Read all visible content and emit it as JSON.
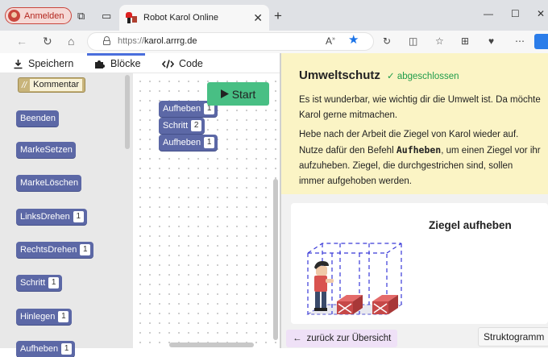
{
  "browser": {
    "profile_label": "Anmelden",
    "tab_title": "Robot Karol Online",
    "url_protocol": "https://",
    "url_host": "karol.arrrg.de",
    "accent_color": "#1a73e8"
  },
  "editor": {
    "tabs": [
      {
        "label": "Speichern",
        "icon": "download-icon"
      },
      {
        "label": "Blöcke",
        "icon": "puzzle-icon"
      },
      {
        "label": "Code",
        "icon": "code-icon"
      }
    ],
    "palette": {
      "comment": {
        "slash": "//",
        "label": "Kommentar"
      },
      "blocks": [
        {
          "label": "Beenden",
          "num": ""
        },
        {
          "label": "MarkeSetzen",
          "num": ""
        },
        {
          "label": "MarkeLöschen",
          "num": ""
        },
        {
          "label": "LinksDrehen",
          "num": "1"
        },
        {
          "label": "RechtsDrehen",
          "num": "1"
        },
        {
          "label": "Schritt",
          "num": "1"
        },
        {
          "label": "Hinlegen",
          "num": "1"
        },
        {
          "label": "Aufheben",
          "num": "1"
        }
      ]
    },
    "program": [
      {
        "label": "Aufheben",
        "num": "1"
      },
      {
        "label": "Schritt",
        "num": "2"
      },
      {
        "label": "Aufheben",
        "num": "1"
      }
    ],
    "start_label": "Start",
    "block_color": "#5c68a6",
    "start_color": "#48bf84"
  },
  "task": {
    "title": "Umweltschutz",
    "status": "abgeschlossen",
    "status_color": "#1f9c4a",
    "para1": "Es ist wunderbar, wie wichtig dir die Umwelt ist. Da möchte Karol gerne mitmachen.",
    "para2_before": "Hebe nach der Arbeit die Ziegel von Karol wieder auf. Nutze dafür den Befehl ",
    "para2_keyword": "Aufheben",
    "para2_after": ", um einen Ziegel vor ihr aufzuheben. Ziegel, die durchgestrichen sind, sollen immer aufgehoben werden.",
    "preview_title": "Ziegel aufheben",
    "back_label": "zurück zur Übersicht",
    "structogram_label": "Struktogramm"
  }
}
